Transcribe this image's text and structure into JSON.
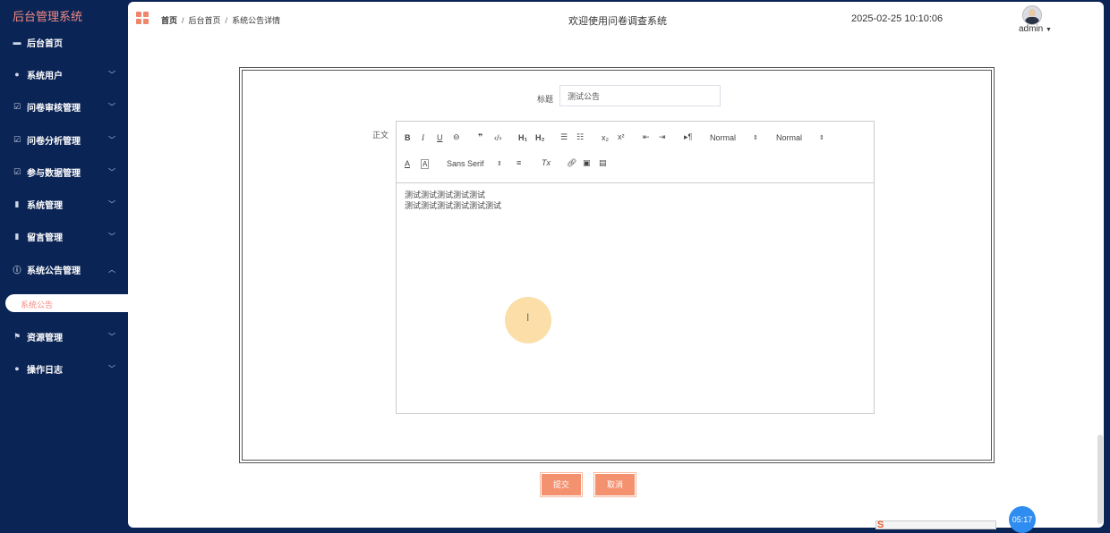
{
  "app": {
    "brand": "后台管理系统"
  },
  "sidebar": {
    "items": [
      {
        "label": "后台首页",
        "icon": "monitor-icon"
      },
      {
        "label": "系统用户",
        "icon": "user-icon"
      },
      {
        "label": "问卷审核管理",
        "icon": "checkbox-icon"
      },
      {
        "label": "问卷分析管理",
        "icon": "checkbox-icon"
      },
      {
        "label": "参与数据管理",
        "icon": "checkbox-icon"
      },
      {
        "label": "系统管理",
        "icon": "bar-chart-icon"
      },
      {
        "label": "留言管理",
        "icon": "bar-chart-icon"
      },
      {
        "label": "系统公告管理",
        "icon": "info-icon"
      },
      {
        "label": "资源管理",
        "icon": "flag-icon"
      },
      {
        "label": "操作日志",
        "icon": "user-icon"
      }
    ],
    "active_sub": "系统公告"
  },
  "header": {
    "breadcrumb": [
      "首页",
      "后台首页",
      "系统公告详情"
    ],
    "welcome": "欢迎使用问卷调查系统",
    "datetime": "2025-02-25 10:10:06",
    "user": "admin"
  },
  "form": {
    "title_label": "标题",
    "title_value": "测试公告",
    "body_label": "正文",
    "toolbar": {
      "header_select": "Normal",
      "size_select": "Normal",
      "font_select": "Sans Serif"
    },
    "content_lines": [
      "测试测试测试测试测试",
      "测试测试测试测试测试测试"
    ]
  },
  "buttons": {
    "submit": "提交",
    "cancel": "取消"
  },
  "taskbar": {
    "time": "05:17"
  }
}
